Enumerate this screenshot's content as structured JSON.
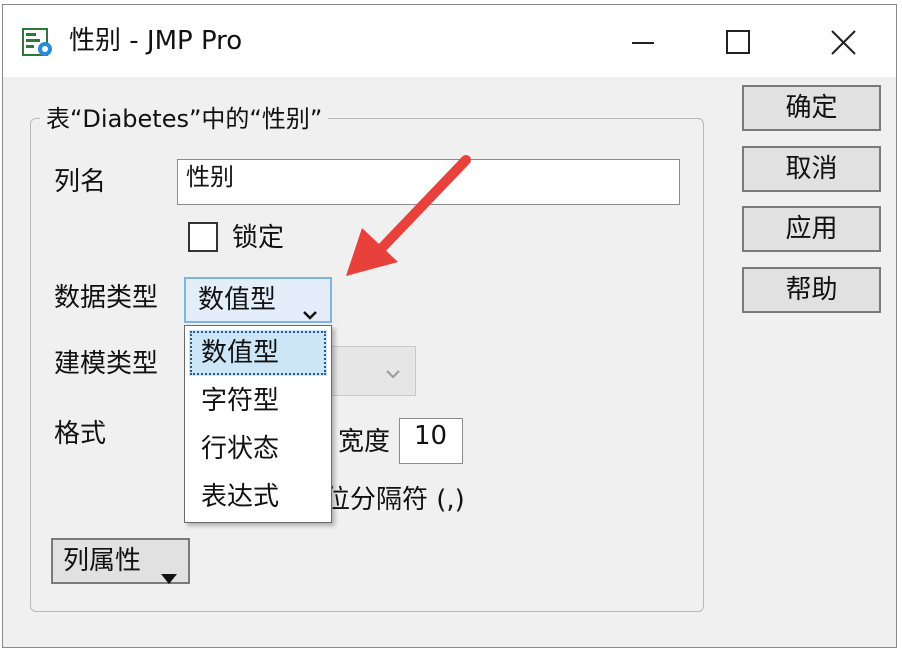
{
  "window": {
    "title": "性别 - JMP Pro",
    "controls": [
      "minimize-icon",
      "maximize-icon",
      "close-icon"
    ]
  },
  "group": {
    "legend": "表“Diabetes”中的“性别”"
  },
  "fields": {
    "column_name_label": "列名",
    "column_name_value": "性别",
    "lock_label": "锁定",
    "lock_checked": false,
    "data_type_label": "数据类型",
    "data_type_value": "数值型",
    "modeling_type_label": "建模类型",
    "format_label": "格式",
    "width_label": "宽度",
    "width_value": "10",
    "separator_label_partial": "位分隔符 (,)"
  },
  "data_type_options": [
    "数值型",
    "字符型",
    "行状态",
    "表达式"
  ],
  "data_type_selected_index": 0,
  "buttons": {
    "ok": "确定",
    "cancel": "取消",
    "apply": "应用",
    "help": "帮助",
    "column_properties": "列属性"
  },
  "colors": {
    "annotation_arrow": "#e8413c",
    "combo_focus_border": "#7fb3e0",
    "dropdown_selected_bg": "#cde6f7"
  }
}
